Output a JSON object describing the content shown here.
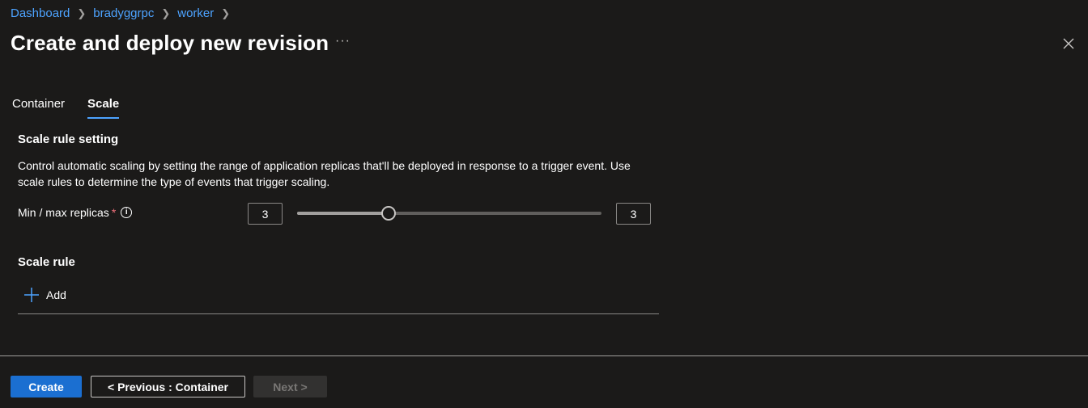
{
  "breadcrumb": [
    "Dashboard",
    "bradyggrpc",
    "worker"
  ],
  "header": {
    "title": "Create and deploy new revision",
    "more_label": "···"
  },
  "tabs": [
    {
      "label": "Container",
      "active": false
    },
    {
      "label": "Scale",
      "active": true
    }
  ],
  "scale_setting": {
    "heading": "Scale rule setting",
    "description": "Control automatic scaling by setting the range of application replicas that'll be deployed in response to a trigger event. Use scale rules to determine the type of events that trigger scaling.",
    "replicas_label": "Min / max replicas",
    "required_mark": "*",
    "info_icon": "i",
    "min_value": "3",
    "max_value": "3",
    "slider_value_fraction": 0.3
  },
  "scale_rule": {
    "heading": "Scale rule",
    "add_label": "Add"
  },
  "footer": {
    "create_label": "Create",
    "previous_label": "< Previous : Container",
    "next_label": "Next >"
  },
  "colors": {
    "background": "#1b1a19",
    "accent": "#4da3ff",
    "primary_button": "#1b6fd1",
    "required": "#f1707b"
  },
  "icons": [
    "chevron-right-icon",
    "more-icon",
    "close-icon",
    "info-icon",
    "plus-icon"
  ]
}
